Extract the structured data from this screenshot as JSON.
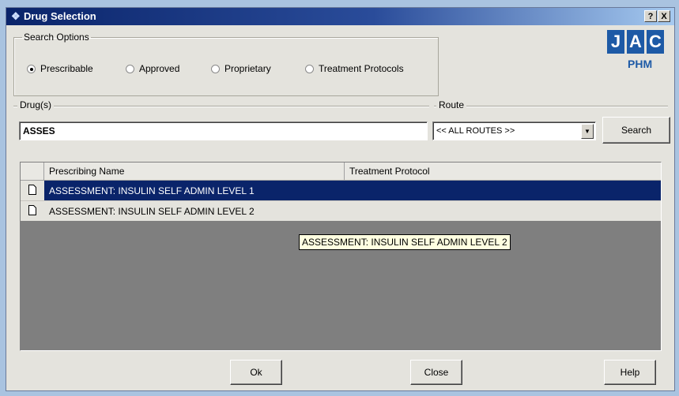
{
  "window": {
    "title": "Drug Selection",
    "help_btn": "?",
    "close_btn": "X"
  },
  "search_options": {
    "legend": "Search Options",
    "options": [
      {
        "label": "Prescribable",
        "selected": true
      },
      {
        "label": "Approved",
        "selected": false
      },
      {
        "label": "Proprietary",
        "selected": false
      },
      {
        "label": "Treatment Protocols",
        "selected": false
      }
    ]
  },
  "logo": {
    "letters": [
      "J",
      "A",
      "C"
    ],
    "subtitle": "PHM",
    "color": "#1d5aa6"
  },
  "drugs": {
    "label": "Drug(s)",
    "value": "ASSES"
  },
  "route": {
    "label": "Route",
    "selected": "<< ALL ROUTES >>"
  },
  "search_button": "Search",
  "grid": {
    "headers": [
      "Prescribing Name",
      "Treatment Protocol"
    ],
    "rows": [
      {
        "name": "ASSESSMENT: INSULIN SELF ADMIN LEVEL 1",
        "protocol": "",
        "selected": true
      },
      {
        "name": "ASSESSMENT: INSULIN SELF ADMIN LEVEL 2",
        "protocol": "",
        "selected": false
      }
    ],
    "selection_color": "#0a246a"
  },
  "tooltip": "ASSESSMENT: INSULIN SELF ADMIN LEVEL 2",
  "buttons": {
    "ok": "Ok",
    "close": "Close",
    "help": "Help"
  }
}
